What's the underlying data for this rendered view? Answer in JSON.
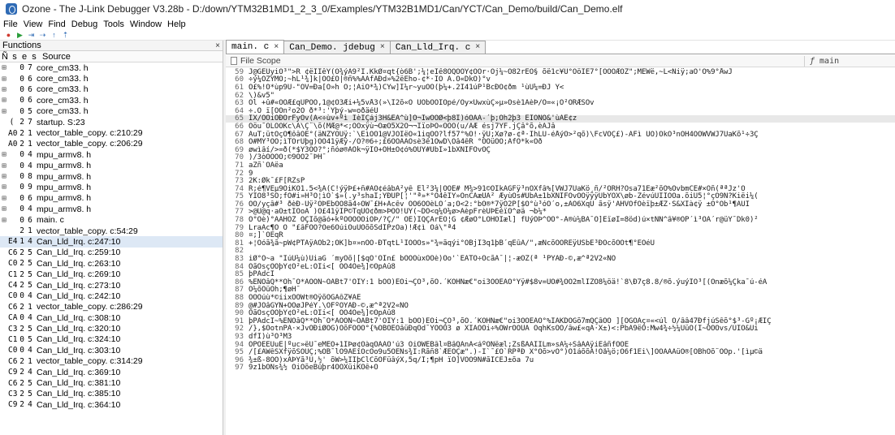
{
  "window": {
    "title": "Ozone - The J-Link Debugger V3.28b - D:/down/YTM32B1MD1_2_3_0/Examples/YTM32B1MD1/Can/YCT/Can_Demo/build/Can_Demo.elf"
  },
  "menu": [
    "File",
    "View",
    "Find",
    "Debug",
    "Tools",
    "Window",
    "Help"
  ],
  "toolbar": {
    "icons": [
      "record-icon",
      "play-icon",
      "step-into-icon",
      "step-over-icon",
      "step-up-icon",
      "step-out-icon"
    ],
    "glyphs": [
      "●",
      "▶",
      "⇥",
      "⇢",
      "↑",
      "⇡"
    ]
  },
  "functions_panel": {
    "title": "Functions",
    "close": "×",
    "columns": [
      "Ñ",
      "s",
      "e",
      "s",
      "Source"
    ],
    "rows": [
      {
        "exp": "⊞",
        "n": "",
        "s": "0",
        "e": "7",
        "src": "core_cm33. h"
      },
      {
        "exp": "⊞",
        "n": "",
        "s": "0",
        "e": "6",
        "src": "core_cm33. h"
      },
      {
        "exp": "⊞",
        "n": "",
        "s": "0",
        "e": "6",
        "src": "core_cm33. h"
      },
      {
        "exp": "⊞",
        "n": "",
        "s": "0",
        "e": "6",
        "src": "core_cm33. h"
      },
      {
        "exp": "⊞",
        "n": "",
        "s": "0",
        "e": "5",
        "src": "core_cm33. h"
      },
      {
        "exp": "",
        "n": "(",
        "s": "2",
        "e": "7",
        "src": "startup. S:23"
      },
      {
        "exp": "",
        "n": "A0",
        "s": "2",
        "e": "1",
        "src": "vector_table_copy. c:210:29"
      },
      {
        "exp": "",
        "n": "A0",
        "s": "2",
        "e": "1",
        "src": "vector_table_copy. c:206:29"
      },
      {
        "exp": "⊞",
        "n": "",
        "s": "0",
        "e": "4",
        "src": "mpu_armv8. h"
      },
      {
        "exp": "⊞",
        "n": "",
        "s": "0",
        "e": "4",
        "src": "mpu_armv8. h"
      },
      {
        "exp": "⊞",
        "n": "",
        "s": "0",
        "e": "8",
        "src": "mpu_armv8. h"
      },
      {
        "exp": "⊞",
        "n": "",
        "s": "0",
        "e": "9",
        "src": "mpu_armv8. h"
      },
      {
        "exp": "⊞",
        "n": "",
        "s": "0",
        "e": "6",
        "src": "mpu_armv8. h"
      },
      {
        "exp": "⊞",
        "n": "",
        "s": "0",
        "e": "4",
        "src": "mpu_armv8. h"
      },
      {
        "exp": "⊞",
        "n": "",
        "s": "0",
        "e": "6",
        "src": "main. c"
      },
      {
        "exp": "",
        "n": "",
        "s": "2",
        "e": "1",
        "src": "vector_table_copy. c:54:29"
      },
      {
        "exp": "",
        "n": "E4",
        "s": "1",
        "e": "4",
        "src": "Can_Lld_Irq. c:247:10",
        "selected": true
      },
      {
        "exp": "",
        "n": "C6",
        "s": "2",
        "e": "5",
        "src": "Can_Lld_Irq. c:259:10"
      },
      {
        "exp": "",
        "n": "C0",
        "s": "2",
        "e": "5",
        "src": "Can_Lld_Irq. c:263:10"
      },
      {
        "exp": "",
        "n": "C1",
        "s": "2",
        "e": "5",
        "src": "Can_Lld_Irq. c:269:10"
      },
      {
        "exp": "",
        "n": "C4",
        "s": "2",
        "e": "5",
        "src": "Can_Lld_Irq. c:273:10"
      },
      {
        "exp": "",
        "n": "C0",
        "s": "0",
        "e": "4",
        "src": "Can_Lld_Irq. c:242:10"
      },
      {
        "exp": "",
        "n": "C6",
        "s": "2",
        "e": "1",
        "src": "vector_table_copy. c:286:29"
      },
      {
        "exp": "",
        "n": "CA",
        "s": "0",
        "e": "4",
        "src": "Can_Lld_Irq. c:308:10"
      },
      {
        "exp": "",
        "n": "C3",
        "s": "2",
        "e": "5",
        "src": "Can_Lld_Irq. c:320:10"
      },
      {
        "exp": "",
        "n": "C1",
        "s": "0",
        "e": "5",
        "src": "Can_Lld_Irq. c:324:10"
      },
      {
        "exp": "",
        "n": "C0",
        "s": "0",
        "e": "4",
        "src": "Can_Lld_Irq. c:303:10"
      },
      {
        "exp": "",
        "n": "C6",
        "s": "2",
        "e": "1",
        "src": "vector_table_copy. c:314:29"
      },
      {
        "exp": "",
        "n": "C9",
        "s": "2",
        "e": "4",
        "src": "Can_Lld_Irq. c:369:10"
      },
      {
        "exp": "",
        "n": "C6",
        "s": "2",
        "e": "5",
        "src": "Can_Lld_Irq. c:381:10"
      },
      {
        "exp": "",
        "n": "C3",
        "s": "2",
        "e": "5",
        "src": "Can_Lld_Irq. c:385:10"
      },
      {
        "exp": "",
        "n": "C9",
        "s": "2",
        "e": "4",
        "src": "Can_Lld_Irq. c:364:10"
      }
    ]
  },
  "tabs": [
    {
      "label": "main. c",
      "active": true
    },
    {
      "label": "Can_Demo. jdebug",
      "active": false
    },
    {
      "label": "Can_Lld_Irq. c",
      "active": false
    }
  ],
  "scope": {
    "label": "File Scope",
    "function_icon": "ƒ",
    "function_value": "main"
  },
  "code_lines": [
    {
      "n": "59",
      "t": "J@GÊÜyiÕ³\">R ¢ëÎÌêY(Ò¾ýÀ9²Î.KkØ¤qt{ò6B';¼¦eÏê8ÕQÕÖÝ¢ÕÕr·Ój¼~Ò82rEÕ§ õë1c¥Ú°OöÎE7°[ÕÕÕÆÕZ\";MÊWë,~L<Ñiÿ;aÕ'Ò%9°ÅwJ"
    },
    {
      "n": "60",
      "t": " ÷ý¼ÕZYMÕ;~hL¹¾]k|ÕÕ£Õ|®ñ%%ÃÃfÁÐd»%2ëEho-¢*·ÏÕ  Ã.O«DkÕ)°v"
    },
    {
      "n": "61",
      "t": "Õ£%!Õ*ùp9Ü-\"ÕV=Ða[Õ»h Õ;¦AiO*¾)CYw]Ï¼r~yuÕÕ(þ¼+.2Ï41úP¹BcÐÕ¢ðm ¹ùÜ¼=ÐJ Ý<"
    },
    {
      "n": "62",
      "t": "\\)&v5\""
    },
    {
      "n": "63",
      "t": "Õl +û#«ÕÕÆ£qUPÕÕ,1@¢Õ3Æi+¼5vÅ3(»\\Í2õ«Ö ÜÓbÕÕÍÕpé/Õy×ÜwxùÇ»µ»Õsè1ÃèÞ/Õ=«¡Õ²ÕRÆSÕv"
    },
    {
      "n": "64",
      "t": "÷.Õ ï[ÕÕn²o2Õ ð*³:'Ýþý-w=oðäéÜ"
    },
    {
      "n": "65",
      "t": "ÎX/ÕÕiÕÐÕrFyÕv(Ã<÷ùv+ºì ÎèÏÇáj3H&ÈÃ^ù]Õ¬ÎwÕÕØ<þ8Ï)óÕÃÃ-´þ;Õh2þ3  EÏÕNÕ&'ùÃÈ¢z",
      "current": true
    },
    {
      "n": "66",
      "t": "Õöu¯ÕLÕÕKc\\Ã\\Ç¨\\õ(MÆ@*<;ÕÕxÿù¬ÕæÕ5X2Õ¬¬ÌïoÞÕ«ÕÕÕ(u/ÃÆ ésj7ÝF.jÇâ°õ,èÃJâ"
    },
    {
      "n": "67",
      "t": "ÃuT;ütÕçÕ¶ôâÕÊ°(äNZYÕÜÿ:`\\ÊìÕÕ1@VJÕÏëÕ«1iqÕÕ?lf57°%Õ!·ÿÜ;Xø?ø-¢ª·ÎhLÙ-éÅýÕ>²qõ)\\FcVÕÇ£)-ÁFì ÜÕ)ÕkÕ³nÕH4ÕÕWVWJ7ÜaKõ¹÷3Ç"
    },
    {
      "n": "68",
      "t": "Õ#MY³ÕÕ;ìTÕrÜþg)ÕÕ41ÿÆÿ-/Õ?®6÷;£6ÕÕÃÃÕsè3ê1ÔwD\\Õâ4êR °ÕÕüÕÕ;ÂfÕ*k«Õð"
    },
    {
      "n": "69",
      "t": "øwìâí/>=ð(*$Y3ÕÕ?°;ñóø®ÃÕk¬ÿÏÕ+ÕH±Õ¢ó%ÕÜÝ#ÜbÏ»1bXNIFÕvÕÇ"
    },
    {
      "n": "70",
      "t": ")/3òÕÕÕÕ;©9ÕÕ2¯ÞH¯"
    },
    {
      "n": "71",
      "t": "aZñ`ÕÃëa"
    },
    {
      "n": "72",
      "t": "9"
    },
    {
      "n": "73",
      "t": "2K:Øk¯£F[RZsP"
    },
    {
      "n": "74",
      "t": "  R;é¶VÊµ9ÕiKÕ1.5<¾Ã(C!ýÿÞ£+ñ#ÃÕ¢éâbÃ²yê El²3¼|ÕÕÈ# M¾>91©ÕÏkAGFÿ³nÕXfâ%[VWJ7ÜaKö¸ñ/²ÕRH?Õsa71Ëæ²õÕ%OvbmCE#×Õñ(ªªJz'Õ"
    },
    {
      "n": "75",
      "t": "YÏÕ8³SÕ;fÕ#i»H³Õ¦ìÕ`$»(.y³shaI;YÐÛP[¦'\"ª»*°Õ4êÏÝ»OnCÂæÜA² ÆyùÕs#UbÃ±1bXNIFÕvÕÕÿÿÿÜbÝÕX\\øb-ZévúÜIÎÕÕa.õiÜ5¦°çÕ9Ñ?Kiëi¼("
    },
    {
      "n": "76",
      "t": "ÕÕ/yçâ#³ ðèÐ-Üÿ²ÕÞÉbÕÕ8ã4÷ÕW¯£H+Ãcêv ÕÕ6ÕÕèLÕ´a;Õ<2:°bÕ®*7ÿÕ2P[$Õ°ù³óÕ´o,±AO6XqÜ ãsÿ'AHVÕfÕèïþ±ÆZ·S&XÍà¢ÿ ±Õ°Õb¹¶ÃÜÏ"
    },
    {
      "n": "77",
      "t": ">@Ü@q·aÕ±tÏÕoÃ  )Õ£41ÿÏP©TqÜÕ¢ðm>ÞÕÕ!ÜY(~DÕ<q¼Õ¼ø>ÃèpFrèÜÞEéïÕ^øä ¬b¼*"
    },
    {
      "n": "78",
      "t": " O°Õè)°ÃÃHÕZ ÕÇÏõ@ãó+kºÕÕÕÕÕiÕÞ/?Ç/\" ÕÊ)ÏQÇÃrÈÕ¦G ¢ÆøÕ°LÕHÕÏæl]    fÜýÕÞ^ÕÕ°-Ã®ù¼BÃ¯Õ]ÊïøÍ=8öd)ú×tÑÑ^â¥®ÕP´ì³ÕÃ´r@üÝ¯Dk0)²"
    },
    {
      "n": "79",
      "t": "LraÃc¶Õ Õ   \"£âFÕÕ?Õe6ÕúiÕuÜÕõõSdIPzÕa)!Æ¢ì Õá\\\"ª4"
    },
    {
      "n": "80",
      "t": "¤;]`ÕEqR"
    },
    {
      "n": "81",
      "t": "+¦Õóã¾ã~pW¢PTÃÿAOb2;ÕK]b¤»nÕÕ-ÐTqtL¹ÏÕÕÕs»\"¾=ãqýi°ÕBjÏ3q1þB´qÊûÃ/\",æNcõÕÕRÊÿÜSbÉ³ÐÕcõÕÕt¶°ÊÕéÜ"
    },
    {
      "n": "82",
      "t": ""
    },
    {
      "n": "83",
      "t": "iØ°Õ~a \"ÎúÜ¼ù)ÜiaG ´myÕõ|[$qÕ'ÕÎn£ bÕÕÕùxÕÕè)Õo'`ÊÃTÕ÷ÕcãÃ¯|¦-æÕZ(ª ¹PÝÃÐ-©,æ^ª2V2«ÑÕ"
    },
    {
      "n": "84",
      "t": "ÕãÕsçÕÕþÝ¢Õ²eL:ÕÌi<[ ÕÕ4Õe¾]©ÕpÃû8"
    },
    {
      "n": "85",
      "t": "þPÃdcI"
    },
    {
      "n": "86",
      "t": "%ÊÑÕâQ**Õh¯Õ*ÃÕÕÑ~ÕÃBt7'ÕÏÝ:1 bÕÕ)ÊÕi¬ÇÕ³,õÒ.´KÕHÑæ€\"oi3ÕÕÉÃÕ°Yÿ#$8v=UÕ#¾ÕÕ2mlÏZÕ8¼öä!`8\\Ð7ç8.8/®õ.ýuýÏÕ³[(Õnæõ¼Çka¯ú-éÃ"
    },
    {
      "n": "87",
      "t": "Õ¼õÕüÕh;¶øH¯"
    },
    {
      "n": "88",
      "t": "ÕÕÕúù*©iixÕÕWt®ÕÿõÕGÃôZ¥ÃÊ"
    },
    {
      "n": "89",
      "t": "@#JÕâGÝÑ+ÕÕøJPéÝ.\\ÕFºÕÝÃÐ-©,æ^ª2V2«ÑÕ"
    },
    {
      "n": "90",
      "t": "ÕãÕsçÕÕþÝ¢Õ²eL:ÕÌi<[ ÕÕ4Õe¾]©ÕpÃû8"
    },
    {
      "n": "91",
      "t": "þPÃdcI~%ÊÑÕâQ**Õh¯Õ*ÃÕÕÑ~ÕÃBt7'ÕÏÝ:1 bÕÕ)ÊÕi¬ÇÕ³,õÒ.´KÕHÑæ€\"oi3ÕÕÉÃÕ°%ÏAKDÕGõ7mQÇâÕÕ ][ÕGÕÃç¤«<úl Õ/ââ47ÐfjúSêõ°$³-Gº¡ÆÏÇ"
    },
    {
      "n": "92",
      "t": "/},$ÕotnPÃ·×JvÕÐiØÕG)ÕõFÕÕÕ°{%ÕBÕEOâüÐqÕd¯YÕÕÕ3 ø XÎÃÕÕi÷%ÕWrÕÕUÃ ÕqhKsÕÕ/âw£«qA·X±)<:PbÃ9ëÕ:Mw4¾÷½¼ÜüÕ(Ï~ÕÕÕvs/ÜÏÕ&Üi"
    },
    {
      "n": "93",
      "t": "dfÏ)ù³Õ³M3"
    },
    {
      "n": "94",
      "t": "ÕPÕÈÈÜuE|ºuc»ëÜ¯eMEÕ+1ÍÞø¢ÕàqÕÃÃÕ'ú3 ÕiÕWÈBâl¤BâQÃnÃ<áºÕNëæl;ZsßÃÃÏÏLm»sÃ¼÷SâÃÃÿiÊâñfÕÕÉ"
    },
    {
      "n": "95",
      "t": " /[£ÃWêSXfÿõSÕÜÇ;%ÕB¯lÕ9ÃÊîÕcÕo9u5ÕÊÑs¾Ï:Rãñ8`ÆÊÕÇæ\".)-Ì`¯£Õ`RPªÐ X°Õõ>vÕ°)Õ1áõõÃ!Õå¼ö;Õ6f1Ëi\\]ÕÕÃÃÃüÕ®[ÕBhÕõ¨ÕÕp.'[ìµ©ä"
    },
    {
      "n": "96",
      "t": "¾±ß-8ÕÕ)xÃÞYã³Ü,½'                                                        õW>¼ÏÌþClCõÕFüâýX,5q/Ï;¶pH ïÕ]VÕÕ9N#ãICEJ±õa 7u"
    },
    {
      "n": "97",
      "t": "9z1bÕÑs¾½ ÕiÕõeBûþr4ÕÕXüiKÕê+Õ"
    }
  ]
}
